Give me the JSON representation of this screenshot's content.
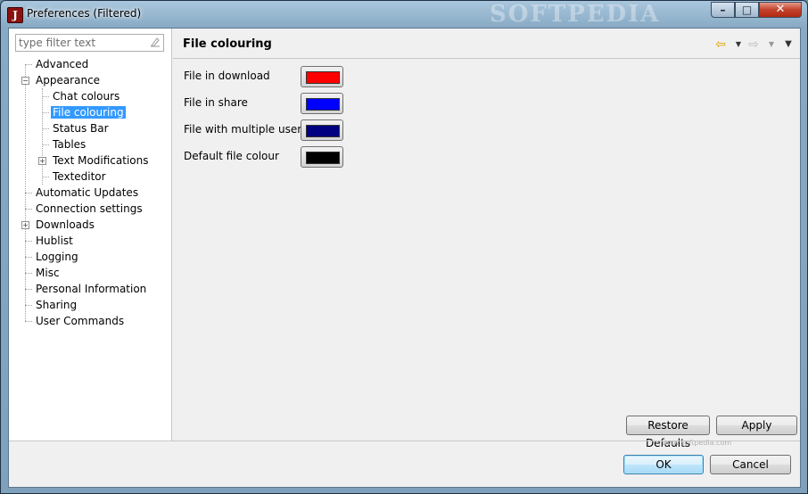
{
  "window": {
    "title": "Preferences (Filtered)",
    "app_icon_letter": "J",
    "watermark": "SOFTPEDIA",
    "controls": {
      "minimize": "–",
      "maximize": "□",
      "close": "✕"
    }
  },
  "filter": {
    "placeholder": "type filter text",
    "clear_icon": "clear-filter-icon"
  },
  "tree": {
    "items": [
      {
        "label": "Advanced"
      },
      {
        "label": "Appearance",
        "expanded": true
      },
      {
        "label": "Chat colours"
      },
      {
        "label": "File colouring",
        "selected": true
      },
      {
        "label": "Status Bar"
      },
      {
        "label": "Tables"
      },
      {
        "label": "Text Modifications",
        "expandable": true
      },
      {
        "label": "Texteditor"
      },
      {
        "label": "Automatic Updates"
      },
      {
        "label": "Connection settings"
      },
      {
        "label": "Downloads",
        "expandable": true
      },
      {
        "label": "Hublist"
      },
      {
        "label": "Logging"
      },
      {
        "label": "Misc"
      },
      {
        "label": "Personal Information"
      },
      {
        "label": "Sharing"
      },
      {
        "label": "User Commands"
      }
    ]
  },
  "page": {
    "title": "File colouring",
    "nav_icons": [
      "back-arrow-icon",
      "back-dropdown-icon",
      "forward-arrow-icon",
      "forward-dropdown-icon",
      "view-menu-icon"
    ],
    "rows": [
      {
        "label": "File in download",
        "color": "#ff0000"
      },
      {
        "label": "File in share",
        "color": "#0000ff"
      },
      {
        "label": "File with multiple users",
        "color": "#000080"
      },
      {
        "label": "Default file colour",
        "color": "#000000"
      }
    ],
    "restore_defaults": "Restore Defaults",
    "apply": "Apply",
    "watermark_small": "www.softpedia.com"
  },
  "dialog": {
    "ok": "OK",
    "cancel": "Cancel"
  }
}
